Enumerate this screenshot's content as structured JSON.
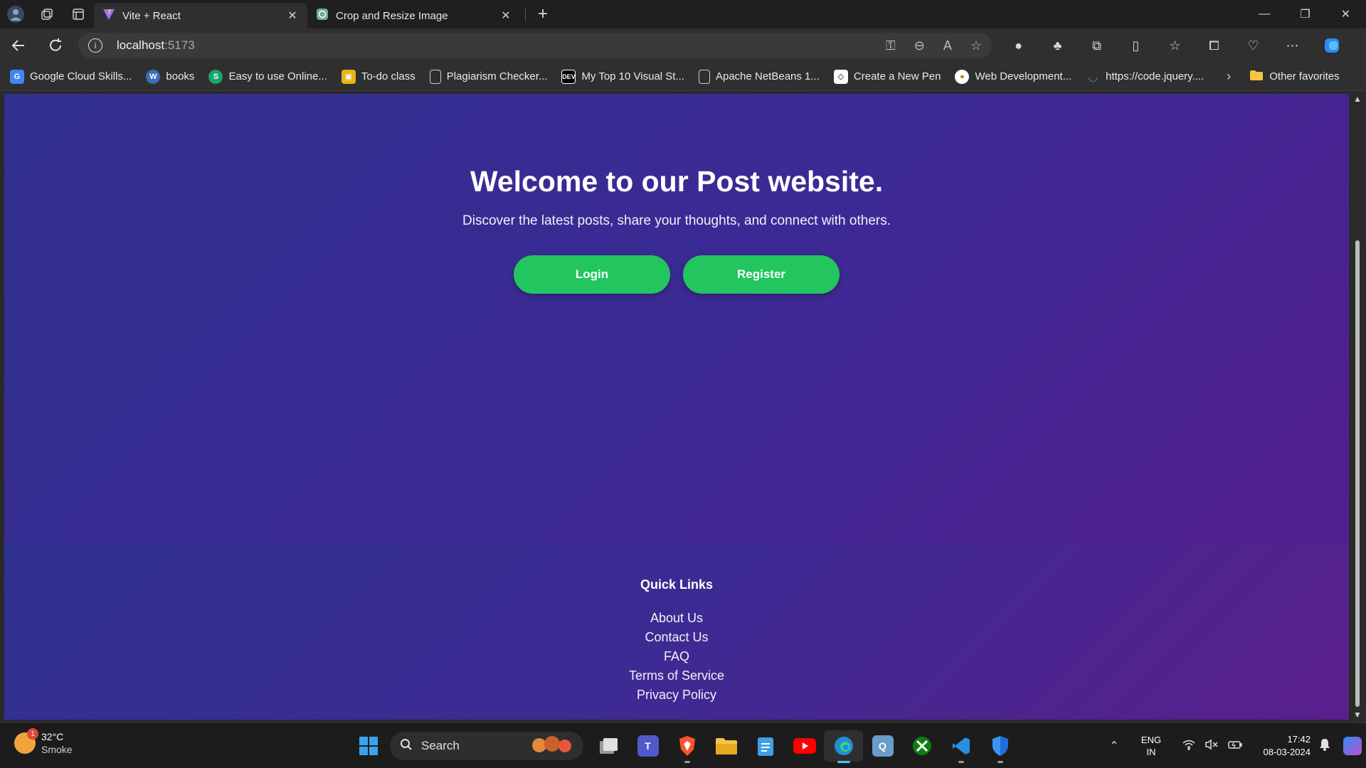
{
  "browser": {
    "tabs": [
      {
        "title": "Vite + React",
        "active": true,
        "icon": "vite-logo-icon"
      },
      {
        "title": "Crop and Resize Image",
        "active": false,
        "icon": "openai-icon"
      }
    ],
    "new_tab": "+",
    "address": {
      "host": "localhost",
      "port": ":5173"
    },
    "window_controls": {
      "minimize": "—",
      "restore": "❐",
      "close": "✕"
    }
  },
  "favorites": {
    "items": [
      {
        "label": "Google Cloud Skills...",
        "icon": "google-cloud-icon",
        "color": "#4285f4"
      },
      {
        "label": "books",
        "icon": "wordpress-icon",
        "color": "#3a6fb0"
      },
      {
        "label": "Easy to use Online...",
        "icon": "s-logo-icon",
        "color": "#18a46f"
      },
      {
        "label": "To-do class",
        "icon": "classroom-icon",
        "color": "#e7b416"
      },
      {
        "label": "Plagiarism Checker...",
        "icon": "page-icon",
        "color": "#555555"
      },
      {
        "label": "My Top 10 Visual St...",
        "icon": "dev-icon",
        "color": "#000000"
      },
      {
        "label": "Apache NetBeans 1...",
        "icon": "page-icon",
        "color": "#555555"
      },
      {
        "label": "Create a New Pen",
        "icon": "codepen-icon",
        "color": "#000000"
      },
      {
        "label": "Web Development...",
        "icon": "circle-logo-icon",
        "color": "#f5d142"
      },
      {
        "label": "https://code.jquery....",
        "icon": "jquery-icon",
        "color": "#0769ad"
      }
    ],
    "more": "›",
    "other": "Other favorites"
  },
  "hero": {
    "title": "Welcome to our Post website.",
    "subtitle": "Discover the latest posts, share your thoughts, and connect with others.",
    "login_label": "Login",
    "register_label": "Register",
    "button_color": "#22c55e"
  },
  "footer": {
    "heading": "Quick Links",
    "links": [
      "About Us",
      "Contact Us",
      "FAQ",
      "Terms of Service",
      "Privacy Policy"
    ]
  },
  "taskbar": {
    "weather": {
      "temp": "32°C",
      "condition": "Smoke",
      "badge": "1"
    },
    "search_placeholder": "Search",
    "apps": [
      "task-view",
      "teams",
      "brave",
      "file-explorer",
      "notepad",
      "youtube",
      "edge",
      "app-q",
      "xbox",
      "vscode",
      "defender"
    ],
    "language": {
      "lang": "ENG",
      "region": "IN"
    },
    "time": "17:42",
    "date": "08-03-2024"
  }
}
